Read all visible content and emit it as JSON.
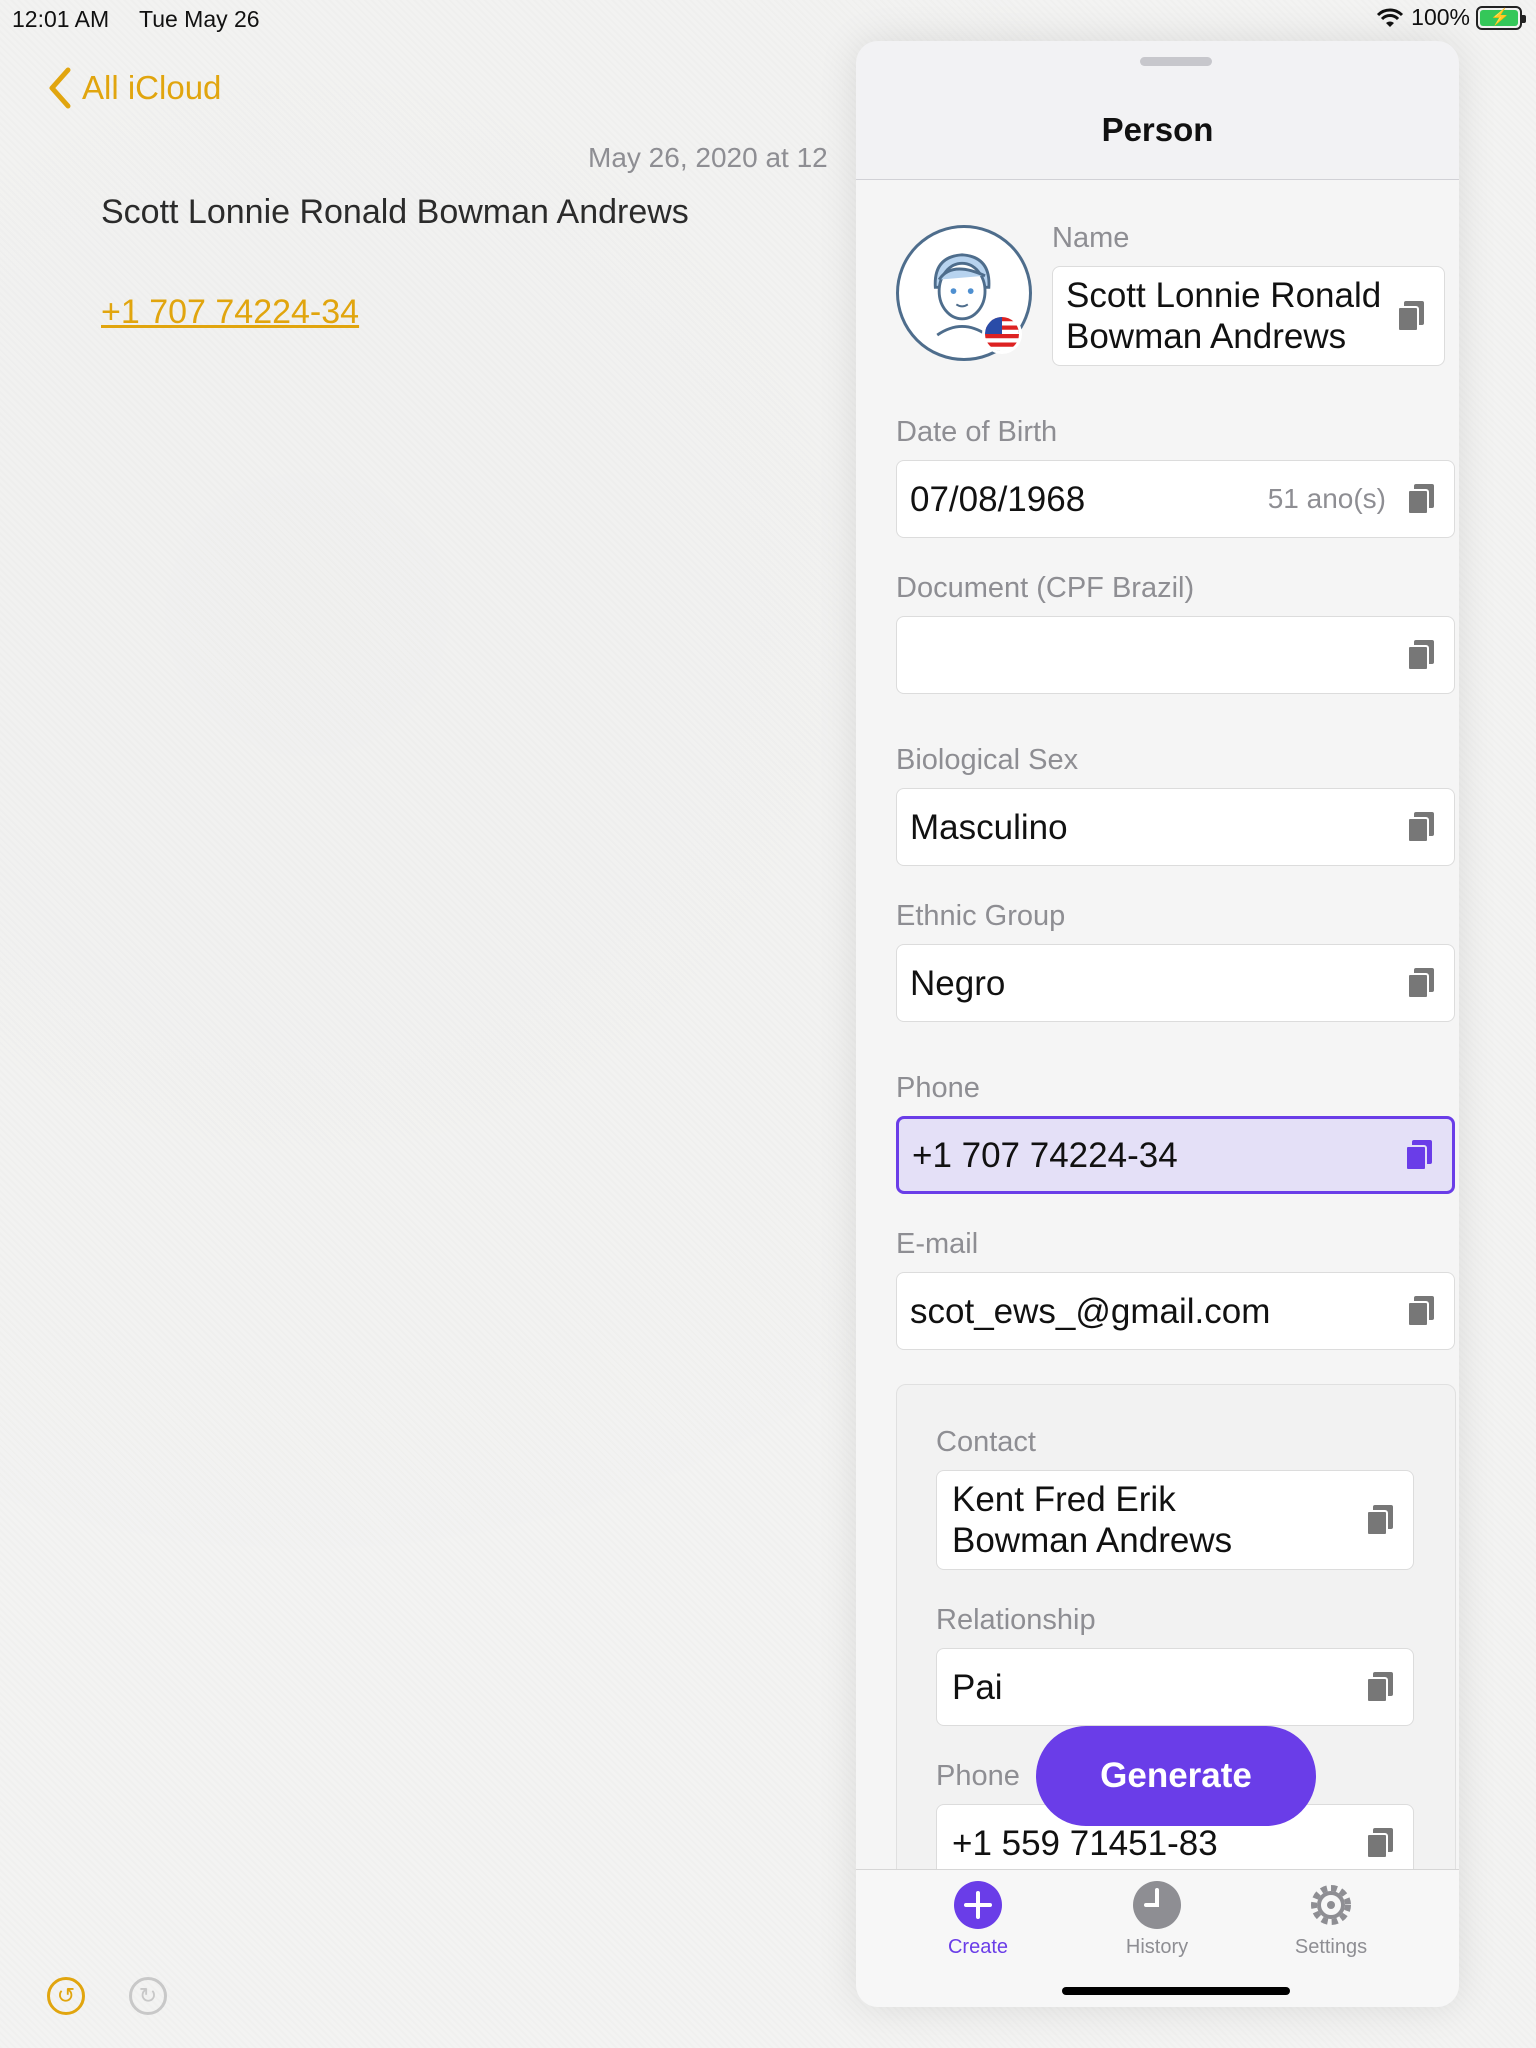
{
  "status_bar": {
    "time": "12:01 AM",
    "date": "Tue May 26",
    "battery": "100%"
  },
  "notes": {
    "back_label": "All iCloud",
    "timestamp": "May 26, 2020 at 12",
    "title": "Scott Lonnie Ronald Bowman Andrews",
    "phone_link": "+1 707 74224-34"
  },
  "panel": {
    "title": "Person",
    "fields": {
      "name_label": "Name",
      "name_line1": "Scott Lonnie Ronald",
      "name_line2": "Bowman Andrews",
      "dob_label": "Date of Birth",
      "dob_value": "07/08/1968",
      "dob_age": "51 ano(s)",
      "document_label": "Document (CPF Brazil)",
      "document_value": "",
      "sex_label": "Biological Sex",
      "sex_value": "Masculino",
      "ethnic_label": "Ethnic Group",
      "ethnic_value": "Negro",
      "phone_label": "Phone",
      "phone_value": "+1 707 74224-34",
      "email_label": "E-mail",
      "email_value": "scot_ews_@gmail.com"
    },
    "contact": {
      "contact_label": "Contact",
      "contact_line1": "Kent Fred Erik",
      "contact_line2": "Bowman Andrews",
      "relationship_label": "Relationship",
      "relationship_value": "Pai",
      "phone_label": "Phone",
      "phone_value": "+1 559 71451-83"
    },
    "generate_label": "Generate",
    "tabs": [
      {
        "label": "Create",
        "icon": "plus-circle-icon"
      },
      {
        "label": "History",
        "icon": "clock-icon"
      },
      {
        "label": "Settings",
        "icon": "gear-icon"
      }
    ]
  },
  "colors": {
    "accent": "#6a3de8",
    "notes_accent": "#e1a50e",
    "active_field_bg": "#e4e0f7"
  }
}
